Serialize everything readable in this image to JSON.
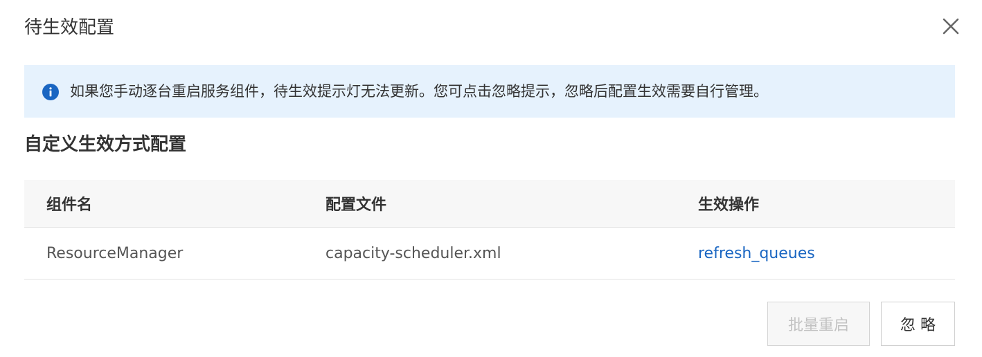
{
  "dialog": {
    "title": "待生效配置"
  },
  "alert": {
    "icon": "info-icon",
    "text": "如果您手动逐台重启服务组件，待生效提示灯无法更新。您可点击忽略提示，忽略后配置生效需要自行管理。",
    "background": "#e6f2fd",
    "icon_color": "#1a66c2"
  },
  "section": {
    "title": "自定义生效方式配置"
  },
  "table": {
    "headers": [
      "组件名",
      "配置文件",
      "生效操作"
    ],
    "rows": [
      {
        "component": "ResourceManager",
        "config_file": "capacity-scheduler.xml",
        "action": "refresh_queues"
      }
    ]
  },
  "buttons": {
    "batch_restart": "批量重启",
    "ignore": "忽 略"
  },
  "colors": {
    "link": "#1a66c2",
    "text": "#333333",
    "disabled_text": "#c2c2c2"
  }
}
